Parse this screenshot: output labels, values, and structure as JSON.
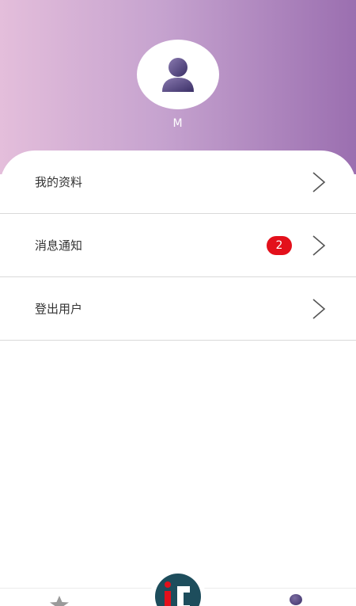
{
  "profile": {
    "username": "M"
  },
  "menu": [
    {
      "label": "我的资料"
    },
    {
      "label": "消息通知",
      "badge": "2"
    },
    {
      "label": "登出用户"
    }
  ],
  "tabbar": {
    "left_icon": "star-icon",
    "center_icon": "ic-logo-icon",
    "right_icon": "profile-dot-icon"
  },
  "colors": {
    "header_gradient_start": "#e4bedb",
    "header_gradient_end": "#9b6fb0",
    "badge": "#e3101b",
    "center_button": "#1d4d5c"
  }
}
